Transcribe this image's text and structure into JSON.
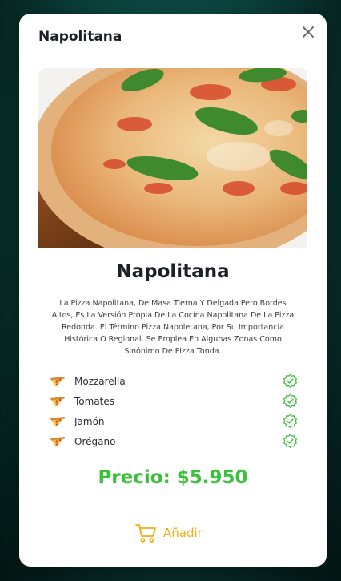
{
  "modal": {
    "title": "Napolitana",
    "close_icon": "close-icon"
  },
  "product": {
    "image_icon": "pizza-photo",
    "name": "Napolitana",
    "description": "La Pizza Napolitana, De Masa Tierna Y Delgada Pero Bordes Altos, Es La Versión Propia De La Cocina Napolitana De La Pizza Redonda. El Término Pizza Napoletana, Por Su Importancia Histórica O Regional, Se Emplea En Algunas Zonas Como Sinónimo De Pizza Tonda.",
    "ingredients": [
      {
        "label": "Mozzarella",
        "icon": "pizza-slice-icon",
        "status_icon": "check-badge-icon"
      },
      {
        "label": "Tomates",
        "icon": "pizza-slice-icon",
        "status_icon": "check-badge-icon"
      },
      {
        "label": "Jamón",
        "icon": "pizza-slice-icon",
        "status_icon": "check-badge-icon"
      },
      {
        "label": "Orégano",
        "icon": "pizza-slice-icon",
        "status_icon": "check-badge-icon"
      }
    ],
    "price_label": "Precio: $5.950"
  },
  "actions": {
    "add_label": "Añadir",
    "add_icon": "cart-icon"
  },
  "colors": {
    "price": "#3ac13a",
    "accent": "#f2ad14",
    "check": "#3ac13a",
    "backdrop": "#0b3f3a"
  }
}
